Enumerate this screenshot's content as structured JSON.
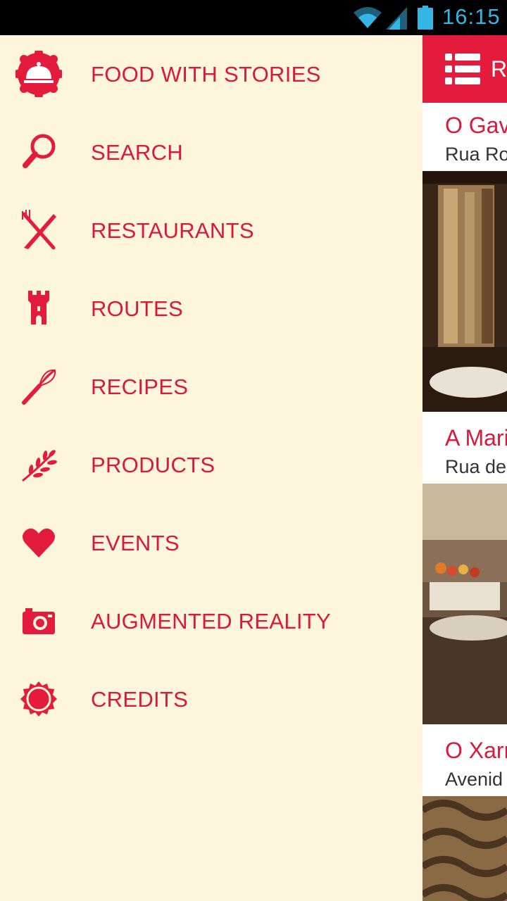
{
  "status": {
    "time": "16:15"
  },
  "drawer": {
    "items": [
      {
        "label": "FOOD WITH STORIES",
        "icon": "cloche-icon"
      },
      {
        "label": "SEARCH",
        "icon": "search-icon"
      },
      {
        "label": "RESTAURANTS",
        "icon": "fork-knife-icon"
      },
      {
        "label": "ROUTES",
        "icon": "tower-icon"
      },
      {
        "label": "RECIPES",
        "icon": "whisk-icon"
      },
      {
        "label": "PRODUCTS",
        "icon": "wheat-branch-icon"
      },
      {
        "label": "EVENTS",
        "icon": "heart-icon"
      },
      {
        "label": "AUGMENTED REALITY",
        "icon": "camera-icon"
      },
      {
        "label": "CREDITS",
        "icon": "badge-icon"
      }
    ]
  },
  "content": {
    "actionbar_title": "Re",
    "cards": [
      {
        "title": "O Gav",
        "subtitle": "Rua Ro"
      },
      {
        "title": "A Mari",
        "subtitle": "Rua de"
      },
      {
        "title": "O Xarr",
        "subtitle": "Avenid"
      }
    ]
  },
  "colors": {
    "accent": "#e31b3d",
    "drawer_bg": "#fdf6dc",
    "label": "#d9183b",
    "status_time": "#33b5e5"
  }
}
